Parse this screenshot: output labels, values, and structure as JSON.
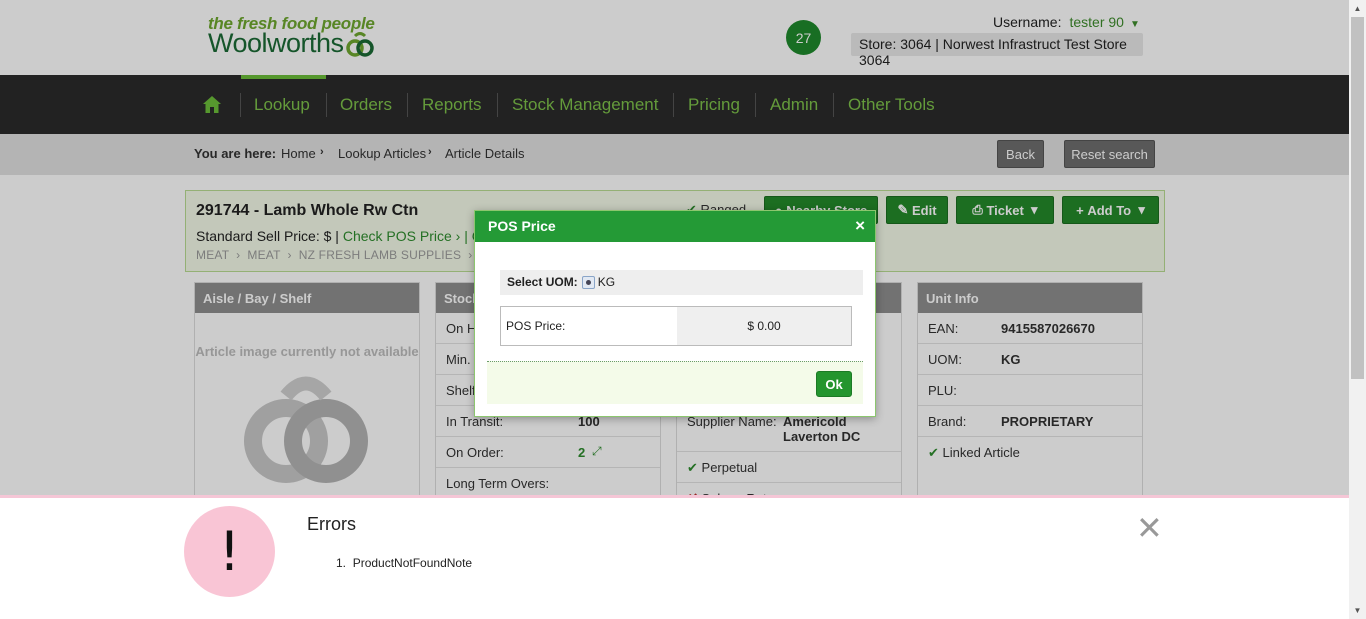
{
  "header": {
    "logo_tagline": "the fresh food people",
    "logo_word": "Woolworths",
    "notification_count": "27",
    "username_label": "Username:",
    "username": "tester 90",
    "store": "Store: 3064 | Norwest Infrastruct Test Store 3064"
  },
  "nav": {
    "items": [
      "Lookup",
      "Orders",
      "Reports",
      "Stock Management",
      "Pricing",
      "Admin",
      "Other Tools"
    ]
  },
  "breadcrumb": {
    "label": "You are here:",
    "items": [
      "Home",
      "Lookup Articles",
      "Article Details"
    ],
    "back": "Back",
    "reset": "Reset search"
  },
  "article": {
    "title": "291744 - Lamb Whole Rw Ctn",
    "sell_prefix": "Standard Sell Price: $ |",
    "check_pos": "Check POS Price",
    "check_other": "| Che",
    "categories": [
      "MEAT",
      "MEAT",
      "NZ FRESH LAMB SUPPLIES"
    ],
    "ranged": "Ranged",
    "nearby": "Nearby Store",
    "edit": "Edit",
    "ticket": "Ticket",
    "add_to": "Add To"
  },
  "panels": {
    "aisle": {
      "title": "Aisle / Bay / Shelf",
      "no_image": "Article image currently not available"
    },
    "stock": {
      "title": "Stock",
      "rows": [
        {
          "k": "On H",
          "v": ""
        },
        {
          "k": "Min. I",
          "v": ""
        },
        {
          "k": "Shelf",
          "v": ""
        },
        {
          "k": "In Transit:",
          "v": "100"
        },
        {
          "k": "On Order:",
          "v": "2"
        },
        {
          "k": "Long Term Overs:",
          "v": ""
        }
      ]
    },
    "supplier": {
      "supplier_label": "Supplier Name:",
      "supplier_value": "Americold Laverton DC",
      "perpetual": "Perpetual",
      "sale_return": "Sale or Return"
    },
    "unit": {
      "title": "Unit Info",
      "rows": [
        {
          "k": "EAN:",
          "v": "9415587026670"
        },
        {
          "k": "UOM:",
          "v": "KG"
        },
        {
          "k": "PLU:",
          "v": ""
        },
        {
          "k": "Brand:",
          "v": "PROPRIETARY"
        }
      ],
      "linked": "Linked Article"
    }
  },
  "modal": {
    "title": "POS Price",
    "close": "×",
    "uom_label": "Select UOM:",
    "uom_value": "KG",
    "pos_label": "POS Price:",
    "pos_value": "$ 0.00",
    "ok": "Ok"
  },
  "errors": {
    "icon": "!",
    "title": "Errors",
    "items": [
      "ProductNotFoundNote"
    ],
    "close": "✕"
  },
  "colors": {
    "brand_green": "#249a36",
    "nav_bg": "#2b2b2b",
    "error_pink": "#f9c5d5"
  }
}
